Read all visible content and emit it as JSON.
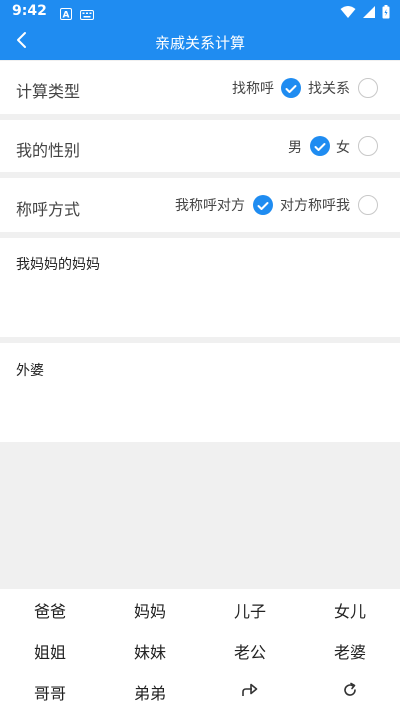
{
  "status_bar": {
    "time": "9:42",
    "left_icons": [
      "font-a-icon",
      "keyboard-icon"
    ],
    "right_icons": [
      "wifi-icon",
      "signal-icon",
      "battery-icon"
    ]
  },
  "app_bar": {
    "title": "亲戚关系计算",
    "back_icon": "chevron-left-icon"
  },
  "calc_type": {
    "label": "计算类型",
    "options": [
      {
        "label": "找称呼",
        "checked": true
      },
      {
        "label": "找关系",
        "checked": false
      }
    ]
  },
  "gender": {
    "label": "我的性别",
    "options": [
      {
        "label": "男",
        "checked": true
      },
      {
        "label": "女",
        "checked": false
      }
    ]
  },
  "address_mode": {
    "label": "称呼方式",
    "options": [
      {
        "label": "我称呼对方",
        "checked": true
      },
      {
        "label": "对方称呼我",
        "checked": false
      }
    ]
  },
  "input": {
    "value": "我妈妈的妈妈"
  },
  "result": {
    "value": "外婆"
  },
  "keyboard": {
    "keys": [
      "爸爸",
      "妈妈",
      "儿子",
      "女儿",
      "姐姐",
      "妹妹",
      "老公",
      "老婆",
      "哥哥",
      "弟弟"
    ],
    "icon_keys": [
      "redo-icon",
      "refresh-icon"
    ]
  },
  "colors": {
    "accent": "#1f8cf1",
    "background": "#f0f0f0"
  }
}
